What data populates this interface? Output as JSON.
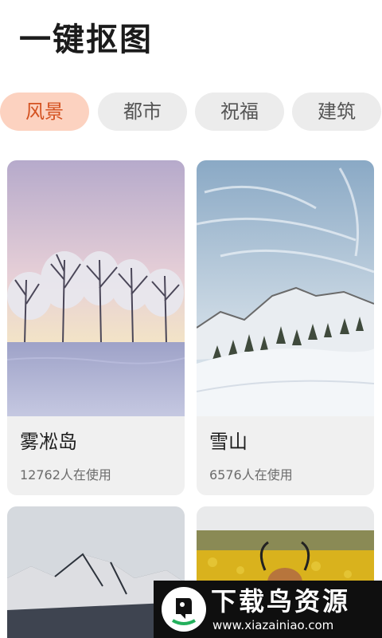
{
  "header": {
    "title": "一键抠图"
  },
  "tabs": [
    {
      "label": "风景",
      "active": true
    },
    {
      "label": "都市",
      "active": false
    },
    {
      "label": "祝福",
      "active": false
    },
    {
      "label": "建筑",
      "active": false
    }
  ],
  "cards": [
    {
      "title": "雾凇岛",
      "usage": "12762人在使用"
    },
    {
      "title": "雪山",
      "usage": "6576人在使用"
    },
    {},
    {}
  ],
  "watermark": {
    "name": "下载鸟资源",
    "url": "www.xiazainiao.com"
  },
  "colors": {
    "accent_bg": "#fcd2c0",
    "accent_text": "#d45221",
    "tab_bg": "#ececec",
    "card_bg": "#f0f0f0"
  }
}
